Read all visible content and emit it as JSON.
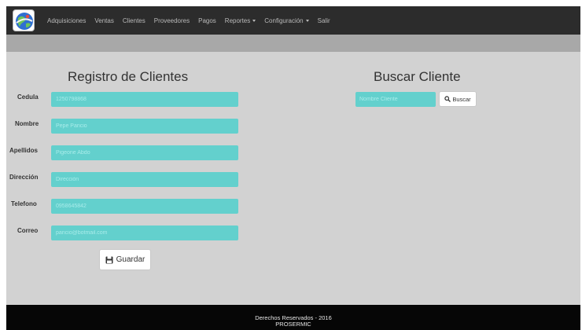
{
  "nav": {
    "logo_icon": "globe-logo-icon",
    "items": [
      {
        "label": "Adquisiciones",
        "dropdown": false
      },
      {
        "label": "Ventas",
        "dropdown": false
      },
      {
        "label": "Clientes",
        "dropdown": false
      },
      {
        "label": "Proveedores",
        "dropdown": false
      },
      {
        "label": "Pagos",
        "dropdown": false
      },
      {
        "label": "Reportes",
        "dropdown": true
      },
      {
        "label": "Configuración",
        "dropdown": true
      },
      {
        "label": "Salir",
        "dropdown": false
      }
    ]
  },
  "registro": {
    "title": "Registro de Clientes",
    "fields": [
      {
        "label": "Cedula",
        "placeholder": "1250798868"
      },
      {
        "label": "Nombre",
        "placeholder": "Pepe Pancio"
      },
      {
        "label": "Apellidos",
        "placeholder": "Pigeone Abdo"
      },
      {
        "label": "Dirección",
        "placeholder": "Dirección"
      },
      {
        "label": "Telefono",
        "placeholder": "0958645842"
      },
      {
        "label": "Correo",
        "placeholder": "pancio@botmail.com"
      }
    ],
    "save_label": "Guardar",
    "save_icon": "floppy-disk-icon"
  },
  "buscar": {
    "title": "Buscar Cliente",
    "placeholder": "Nombre Cliente",
    "button_label": "Buscar",
    "button_icon": "search-icon"
  },
  "footer": {
    "line1": "Derechos Reservados - 2016",
    "line2": "PROSERMIC"
  },
  "colors": {
    "navbar": "#2c2c2c",
    "subbar": "#a8a8a8",
    "page": "#d2d2d2",
    "field": "#63d0cd",
    "footer": "#060606"
  }
}
